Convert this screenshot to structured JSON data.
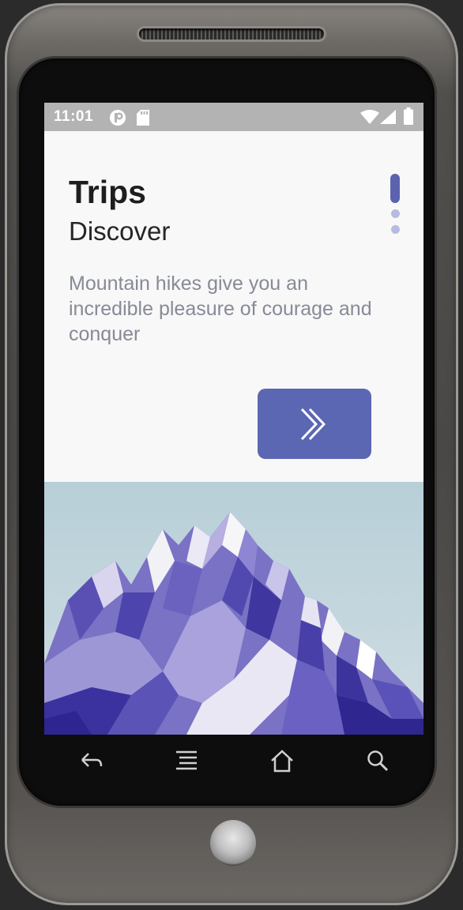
{
  "status_bar": {
    "time": "11:01",
    "left_icons": [
      "app-notification-icon",
      "sd-card-icon"
    ],
    "right_icons": [
      "wifi-icon",
      "cell-signal-icon",
      "battery-icon"
    ]
  },
  "screen": {
    "title": "Trips",
    "subtitle": "Discover",
    "description": "Mountain hikes give you an incredible pleasure of courage and conquer",
    "page_indicator": {
      "total": 3,
      "active_index": 0
    },
    "next_button": {
      "icon": "double-chevron-right-icon"
    },
    "hero_image": "low-poly-mountain-illustration"
  },
  "nav_bar": {
    "buttons": [
      "back-icon",
      "menu-icon",
      "home-icon",
      "search-icon"
    ]
  },
  "colors": {
    "accent": "#5b67b3",
    "indicator_active": "#5b63b1",
    "indicator_inactive": "#b8bbe0",
    "title_text": "#1e1e1e",
    "description_text": "#878a97",
    "background": "#f8f8f8"
  }
}
